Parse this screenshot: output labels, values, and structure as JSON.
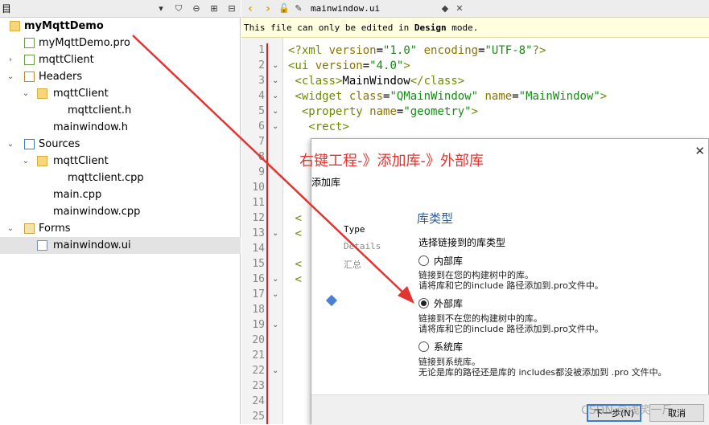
{
  "left_panel": {
    "title": "目"
  },
  "tree": [
    {
      "label": "myMqttDemo",
      "kind": "proj"
    },
    {
      "label": "myMqttDemo.pro",
      "kind": "pro"
    },
    {
      "label": "mqttClient",
      "kind": "pro"
    },
    {
      "label": "Headers",
      "kind": "hdr"
    },
    {
      "label": "mqttClient",
      "kind": "fold"
    },
    {
      "label": "mqttclient.h",
      "kind": "file"
    },
    {
      "label": "mainwindow.h",
      "kind": "file"
    },
    {
      "label": "Sources",
      "kind": "src"
    },
    {
      "label": "mqttClient",
      "kind": "fold"
    },
    {
      "label": "mqttclient.cpp",
      "kind": "file"
    },
    {
      "label": "main.cpp",
      "kind": "file"
    },
    {
      "label": "mainwindow.cpp",
      "kind": "file"
    },
    {
      "label": "Forms",
      "kind": "frm"
    },
    {
      "label": "mainwindow.ui",
      "kind": "ui"
    }
  ],
  "editor": {
    "tab": "mainwindow.ui",
    "notice": {
      "pre": "This file can only be edited in ",
      "bold": "Design",
      "post": " mode."
    },
    "line_numbers": [
      "1",
      "2",
      "3",
      "4",
      "5",
      "6",
      "7",
      "8",
      "9",
      "10",
      "11",
      "12",
      "13",
      "14",
      "15",
      "16",
      "17",
      "18",
      "19",
      "20",
      "21",
      "22",
      "23",
      "24",
      "25"
    ],
    "code": [
      [
        "<?xml version=\"1.0\" encoding=\"UTF-8\"?>"
      ],
      [
        "<ui version=\"4.0\">"
      ],
      [
        " <class>MainWindow</class>"
      ],
      [
        " <widget class=\"QMainWindow\" name=\"MainWindow\">"
      ],
      [
        "  <property name=\"geometry\">"
      ],
      [
        "   <rect>"
      ],
      [
        " <"
      ],
      [
        " <"
      ],
      [
        " <"
      ],
      [
        " <"
      ]
    ]
  },
  "annotation": "右键工程-》添加库-》外部库",
  "dialog": {
    "title": "添加库",
    "steps": [
      "Type",
      "Details",
      "汇总"
    ],
    "heading": "库类型",
    "subheading": "选择链接到的库类型",
    "options": [
      {
        "label": "内部库",
        "checked": false,
        "desc1": "链接到在您的构建树中的库。",
        "desc2": "请将库和它的include 路径添加到.pro文件中。"
      },
      {
        "label": "外部库",
        "checked": true,
        "desc1": "链接到不在您的构建树中的库。",
        "desc2": "请将库和它的include 路径添加到.pro文件中。"
      },
      {
        "label": "系统库",
        "checked": false,
        "desc1": "链接到系统库。",
        "desc2": "无论是库的路径还是库的 includes都没被添加到 .pro 文件中。"
      }
    ],
    "next_label": "下一步(N)",
    "cancel_label": "取消",
    "close_label": "✕"
  },
  "watermark": "CSDN @浅笑一斤"
}
